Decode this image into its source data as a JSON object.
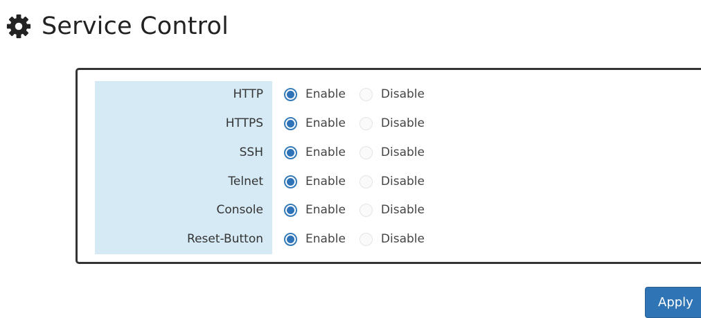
{
  "page": {
    "title": "Service Control",
    "title_icon": "gear-icon"
  },
  "services": [
    {
      "label": "HTTP",
      "selected": "Enable",
      "enable_label": "Enable",
      "disable_label": "Disable"
    },
    {
      "label": "HTTPS",
      "selected": "Enable",
      "enable_label": "Enable",
      "disable_label": "Disable"
    },
    {
      "label": "SSH",
      "selected": "Enable",
      "enable_label": "Enable",
      "disable_label": "Disable"
    },
    {
      "label": "Telnet",
      "selected": "Enable",
      "enable_label": "Enable",
      "disable_label": "Disable"
    },
    {
      "label": "Console",
      "selected": "Enable",
      "enable_label": "Enable",
      "disable_label": "Disable"
    },
    {
      "label": "Reset-Button",
      "selected": "Enable",
      "enable_label": "Enable",
      "disable_label": "Disable"
    }
  ],
  "actions": {
    "apply_label": "Apply"
  },
  "colors": {
    "accent": "#2f74b5",
    "label_background": "#d6eaf5",
    "panel_border": "#333333"
  }
}
